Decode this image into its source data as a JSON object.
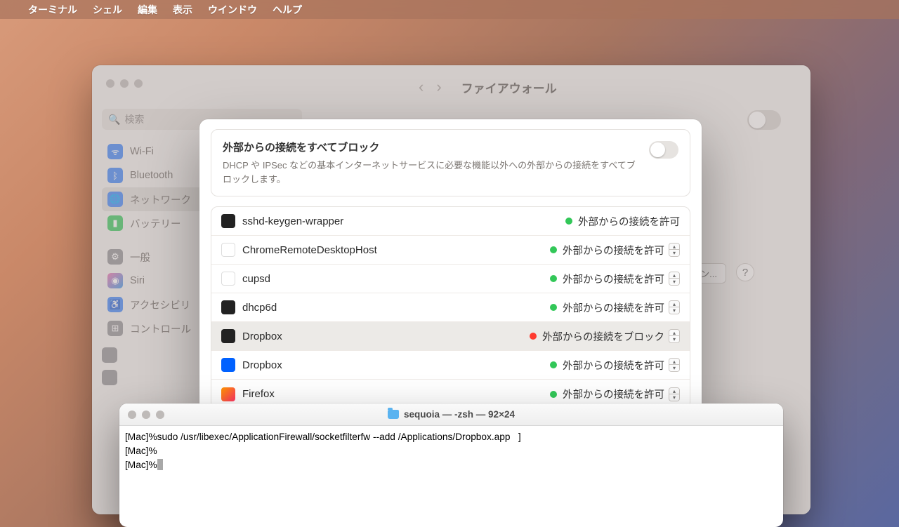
{
  "menubar": {
    "app": "ターミナル",
    "items": [
      "シェル",
      "編集",
      "表示",
      "ウインドウ",
      "ヘルプ"
    ]
  },
  "settings": {
    "title": "ファイアウォール",
    "search_placeholder": "検索",
    "options_button": "プション...",
    "help_button": "?",
    "sidebar": [
      {
        "label": "Wi-Fi"
      },
      {
        "label": "Bluetooth"
      },
      {
        "label": "ネットワーク"
      },
      {
        "label": "バッテリー"
      },
      {
        "label": "一般"
      },
      {
        "label": "Siri"
      },
      {
        "label": "アクセシビリ"
      },
      {
        "label": "コントロール"
      }
    ]
  },
  "sheet": {
    "block_all_title": "外部からの接続をすべてブロック",
    "block_all_desc": "DHCP や IPSec などの基本インターネットサービスに必要な機能以外への外部からの接続をすべてブロックします。",
    "allow_text": "外部からの接続を許可",
    "block_text": "外部からの接続をブロック",
    "apps": [
      {
        "name": "sshd-keygen-wrapper",
        "status": "allow",
        "icon": "exec",
        "stepper": false,
        "selected": false
      },
      {
        "name": "ChromeRemoteDesktopHost",
        "status": "allow",
        "icon": "chrome",
        "stepper": true,
        "selected": false
      },
      {
        "name": "cupsd",
        "status": "allow",
        "icon": "blank",
        "stepper": true,
        "selected": false
      },
      {
        "name": "dhcp6d",
        "status": "allow",
        "icon": "exec",
        "stepper": true,
        "selected": false
      },
      {
        "name": "Dropbox",
        "status": "block",
        "icon": "exec",
        "stepper": true,
        "selected": true
      },
      {
        "name": "Dropbox",
        "status": "allow",
        "icon": "dropbox",
        "stepper": true,
        "selected": false
      },
      {
        "name": "Firefox",
        "status": "allow",
        "icon": "firefox",
        "stepper": true,
        "selected": false
      }
    ]
  },
  "terminal": {
    "title": "sequoia — -zsh — 92×24",
    "lines": [
      "[Mac]%sudo /usr/libexec/ApplicationFirewall/socketfilterfw --add /Applications/Dropbox.app   ]",
      "[Mac]%",
      "[Mac]%"
    ]
  }
}
